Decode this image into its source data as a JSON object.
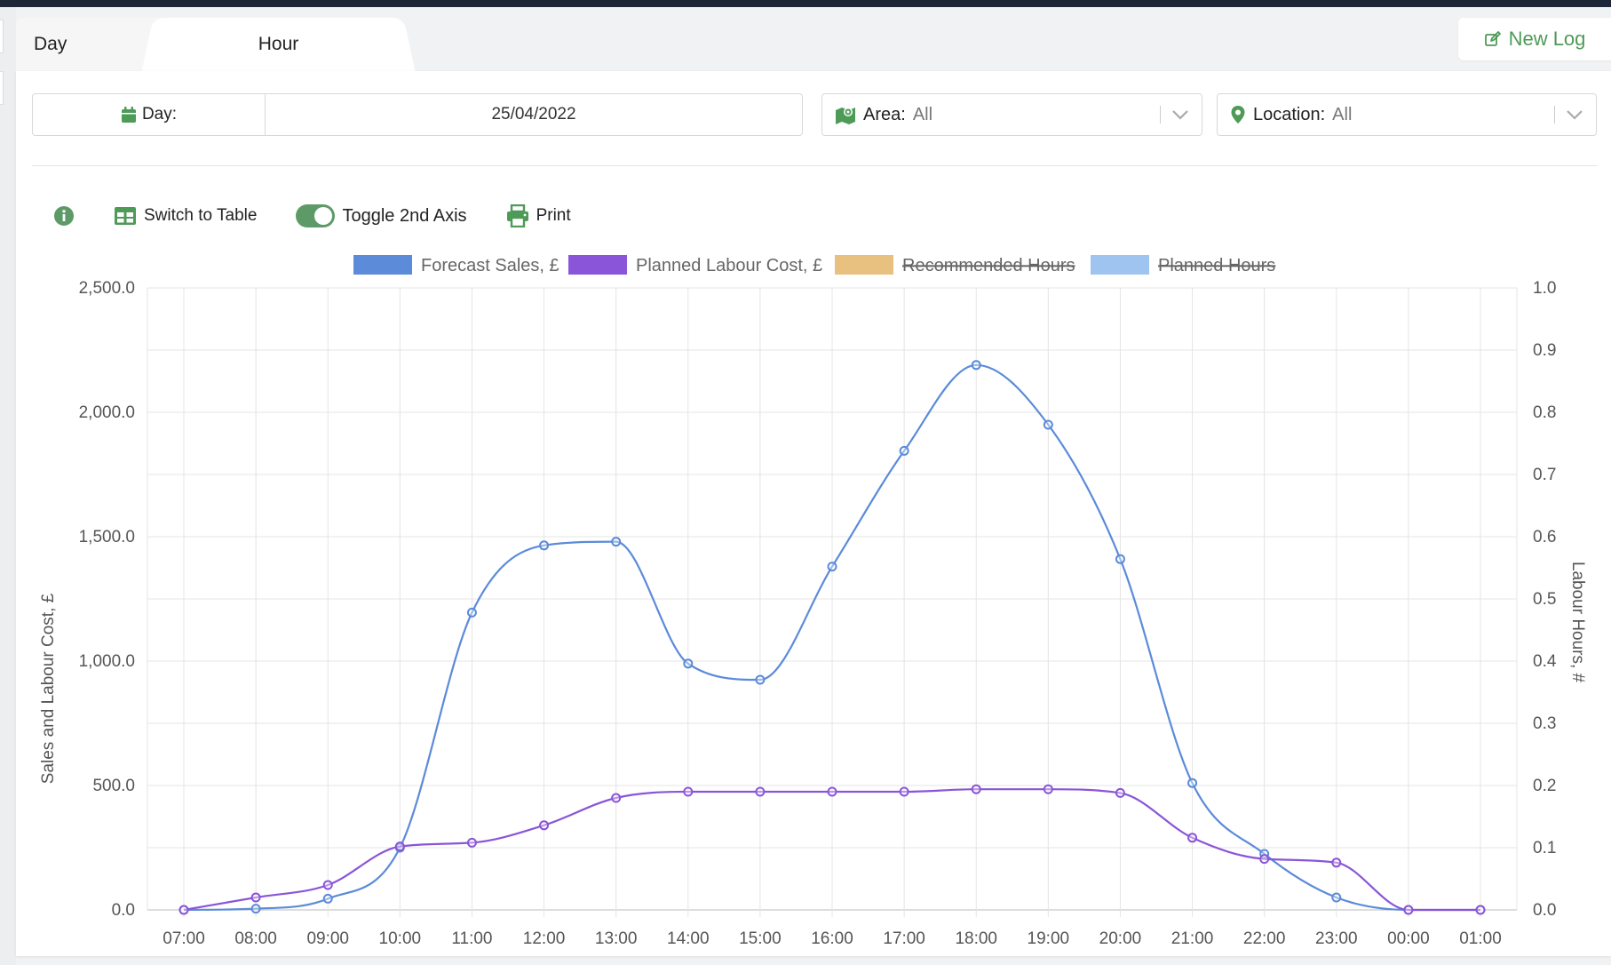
{
  "tabs": [
    {
      "label": "Day"
    },
    {
      "label": "Hour"
    }
  ],
  "new_log": {
    "label": "New Log"
  },
  "filters": {
    "day": {
      "label": "Day:",
      "value": "25/04/2022"
    },
    "area": {
      "label": "Area:",
      "value": "All"
    },
    "location": {
      "label": "Location:",
      "value": "All"
    }
  },
  "toolbar": {
    "switch_table": "Switch to Table",
    "toggle_axis": "Toggle 2nd Axis",
    "print": "Print"
  },
  "colors": {
    "accent": "#5e9a67",
    "forecast_sales": "#5b8bd9",
    "planned_labour": "#8a55d8",
    "recommended_hours": "#e8c080",
    "planned_hours": "#9fc4ef"
  },
  "chart_data": {
    "type": "line",
    "xlabel": "",
    "ylabel": "Sales and Labour Cost, £",
    "y2label": "Labour Hours, #",
    "ylim": [
      0,
      2500
    ],
    "y2lim": [
      0,
      1.0
    ],
    "yticks": [
      "0.0",
      "500.0",
      "1,000.0",
      "1,500.0",
      "2,000.0",
      "2,500.0"
    ],
    "y2ticks": [
      "0.0",
      "0.1",
      "0.2",
      "0.3",
      "0.4",
      "0.5",
      "0.6",
      "0.7",
      "0.8",
      "0.9",
      "1.0"
    ],
    "categories": [
      "07:00",
      "08:00",
      "09:00",
      "10:00",
      "11:00",
      "12:00",
      "13:00",
      "14:00",
      "15:00",
      "16:00",
      "17:00",
      "18:00",
      "19:00",
      "20:00",
      "21:00",
      "22:00",
      "23:00",
      "00:00",
      "01:00"
    ],
    "grid": true,
    "legend_position": "top",
    "series": [
      {
        "name": "Forecast Sales, £",
        "color": "#5b8bd9",
        "hidden": false,
        "values": [
          0,
          5,
          45,
          250,
          1195,
          1465,
          1480,
          990,
          925,
          1380,
          1845,
          2190,
          1950,
          1410,
          510,
          225,
          50,
          0,
          0
        ]
      },
      {
        "name": "Planned Labour Cost, £",
        "color": "#8a55d8",
        "hidden": false,
        "values": [
          0,
          50,
          100,
          255,
          270,
          340,
          450,
          475,
          475,
          475,
          475,
          485,
          485,
          470,
          290,
          205,
          190,
          0,
          0
        ]
      },
      {
        "name": "Recommended Hours",
        "color": "#e8c080",
        "hidden": true,
        "values": []
      },
      {
        "name": "Planned Hours",
        "color": "#9fc4ef",
        "hidden": true,
        "values": []
      }
    ]
  }
}
